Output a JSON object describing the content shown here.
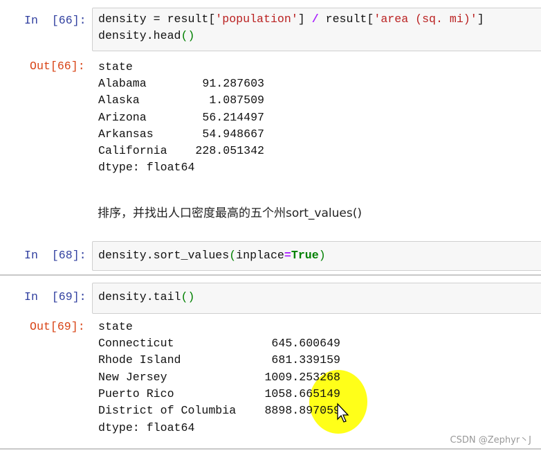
{
  "cells": [
    {
      "prompt": "In  [66]:",
      "code_lines": [
        {
          "a": "density = result[",
          "s1": "'population'",
          "b": "] ",
          "op": "/",
          "c": " result[",
          "s2": "'area (sq. mi)'",
          "d": "]"
        },
        {
          "a": "density.head",
          "p": "()"
        }
      ]
    },
    {
      "prompt": "Out[66]:",
      "header": "state",
      "rows": [
        {
          "label": "Alabama",
          "value": "91.287603"
        },
        {
          "label": "Alaska",
          "value": "1.087509"
        },
        {
          "label": "Arizona",
          "value": "56.214497"
        },
        {
          "label": "Arkansas",
          "value": "54.948667"
        },
        {
          "label": "California",
          "value": "228.051342"
        }
      ],
      "dtype": "dtype: float64"
    },
    {
      "markdown": "排序，并找出人口密度最高的五个州sort_values()"
    },
    {
      "prompt": "In  [68]:",
      "code": {
        "a": "density.sort_values",
        "p1": "(",
        "b": "inplace",
        "eq": "=",
        "kw": "True",
        "p2": ")"
      }
    },
    {
      "prompt": "In  [69]:",
      "code": {
        "a": "density.tail",
        "p": "()"
      }
    },
    {
      "prompt": "Out[69]:",
      "header": "state",
      "rows": [
        {
          "label": "Connecticut",
          "value": "645.600649"
        },
        {
          "label": "Rhode Island",
          "value": "681.339159"
        },
        {
          "label": "New Jersey",
          "value": "1009.253268"
        },
        {
          "label": "Puerto Rico",
          "value": "1058.665149"
        },
        {
          "label": "District of Columbia",
          "value": "8898.897059"
        }
      ],
      "dtype": "dtype: float64"
    }
  ],
  "watermark": "CSDN @Zephyr丶J",
  "colors": {
    "prompt_in": "#303f9f",
    "prompt_out": "#d84315",
    "string": "#ba2121",
    "highlight": "#ffff00"
  }
}
